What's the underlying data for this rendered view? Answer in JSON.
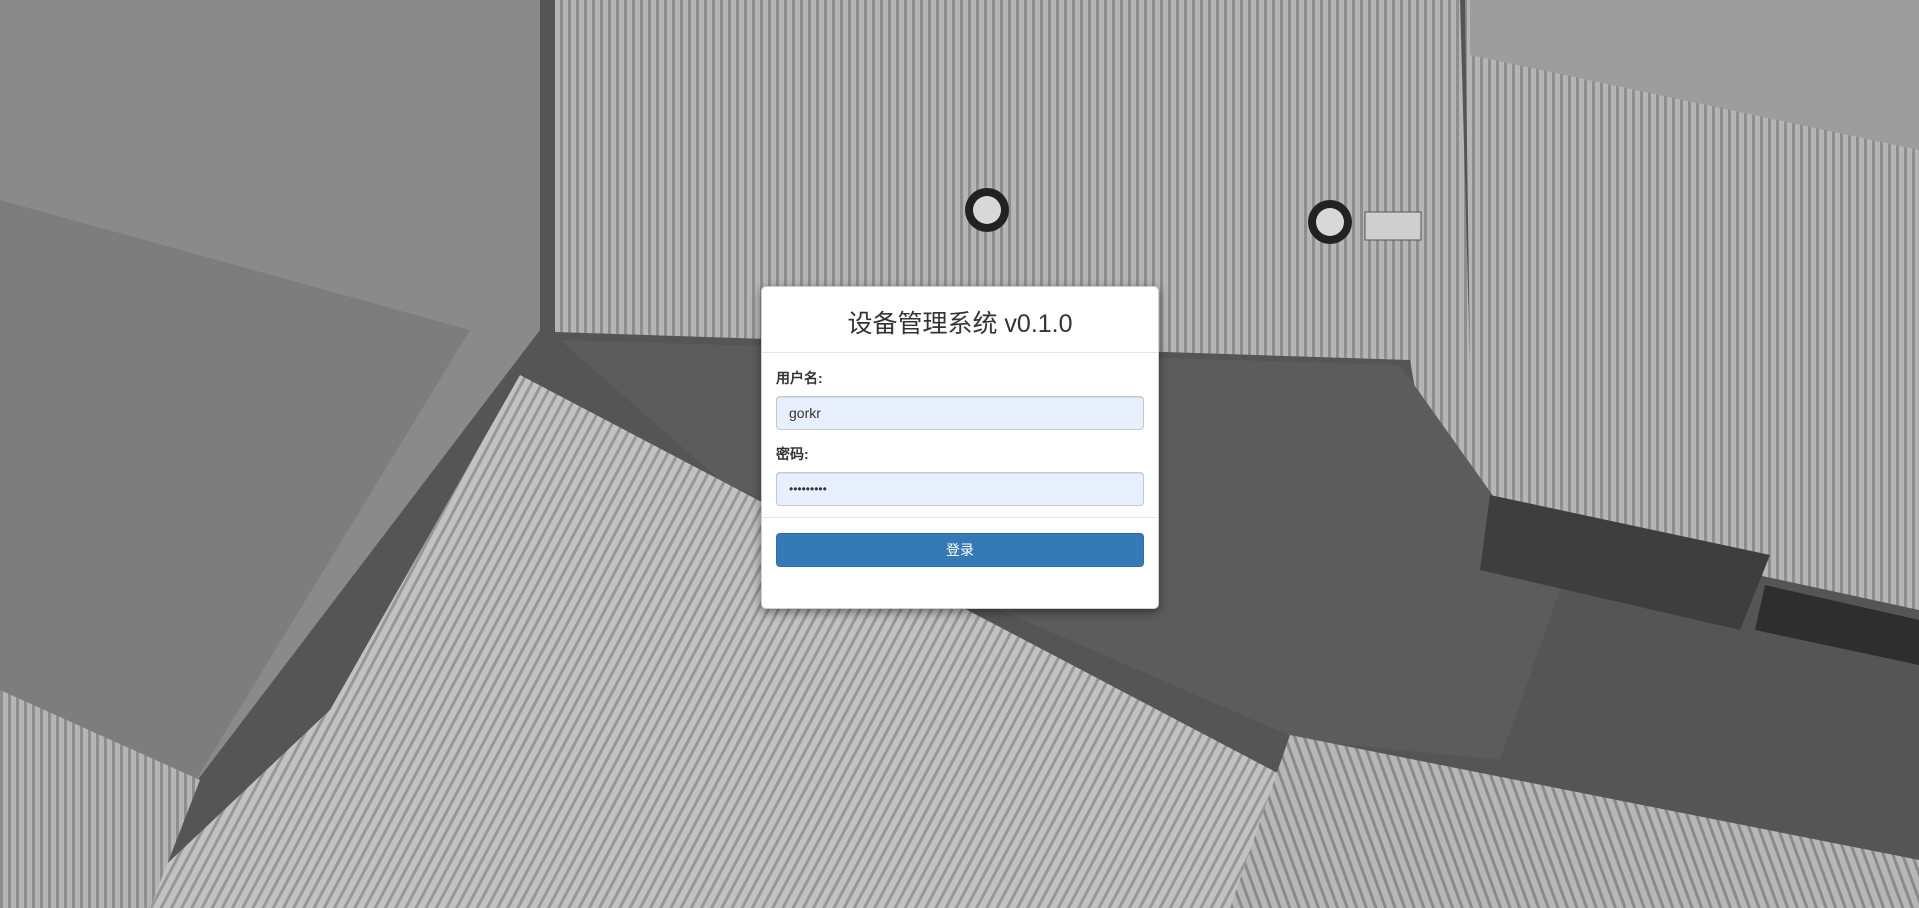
{
  "login": {
    "title": "设备管理系统 v0.1.0",
    "username_label": "用户名:",
    "username_value": "gorkr",
    "password_label": "密码:",
    "password_value": "•••••••••",
    "submit_label": "登录"
  },
  "background": {
    "description_icon": "aerial-rooftops-photo",
    "colors": {
      "base": "#6f6f6f",
      "roof_light": "#b9b9b9",
      "roof_mid": "#9a9a9a",
      "ground_dark": "#4a4a4a",
      "accent_button": "#337ab7",
      "input_fill": "#e8f0fe"
    }
  }
}
